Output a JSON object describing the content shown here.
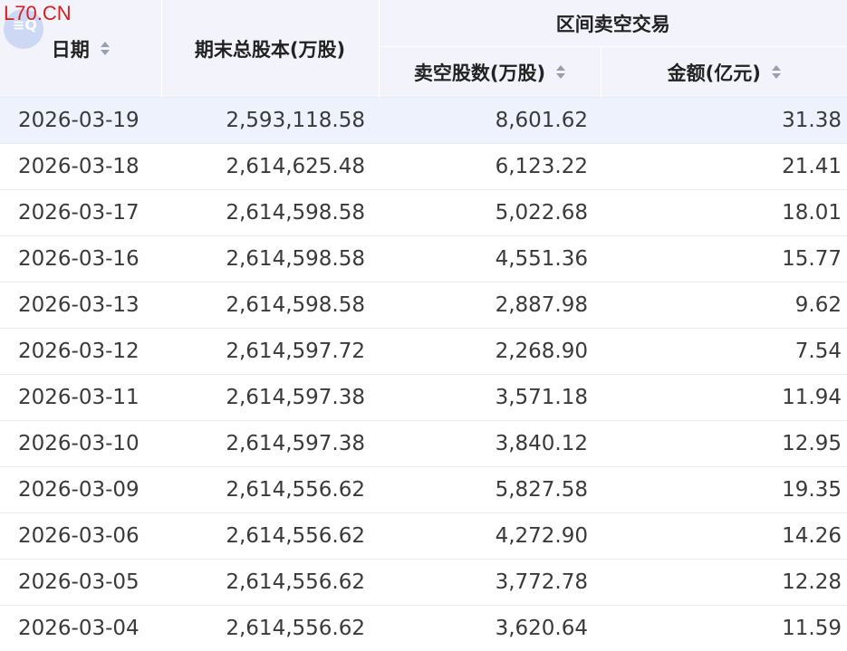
{
  "watermark": {
    "text": "L70.CN",
    "icon_glyph": "≡Q",
    "color": "#d81e1e"
  },
  "headers": {
    "date": "日期",
    "total_shares": "期末总股本(万股)",
    "short_group": "区间卖空交易",
    "short_count": "卖空股数(万股)",
    "amount": "金额(亿元)"
  },
  "rows": [
    {
      "date": "2026-03-19",
      "total_shares": "2,593,118.58",
      "short_count": "8,601.62",
      "amount": "31.38"
    },
    {
      "date": "2026-03-18",
      "total_shares": "2,614,625.48",
      "short_count": "6,123.22",
      "amount": "21.41"
    },
    {
      "date": "2026-03-17",
      "total_shares": "2,614,598.58",
      "short_count": "5,022.68",
      "amount": "18.01"
    },
    {
      "date": "2026-03-16",
      "total_shares": "2,614,598.58",
      "short_count": "4,551.36",
      "amount": "15.77"
    },
    {
      "date": "2026-03-13",
      "total_shares": "2,614,598.58",
      "short_count": "2,887.98",
      "amount": "9.62"
    },
    {
      "date": "2026-03-12",
      "total_shares": "2,614,597.72",
      "short_count": "2,268.90",
      "amount": "7.54"
    },
    {
      "date": "2026-03-11",
      "total_shares": "2,614,597.38",
      "short_count": "3,571.18",
      "amount": "11.94"
    },
    {
      "date": "2026-03-10",
      "total_shares": "2,614,597.38",
      "short_count": "3,840.12",
      "amount": "12.95"
    },
    {
      "date": "2026-03-09",
      "total_shares": "2,614,556.62",
      "short_count": "5,827.58",
      "amount": "19.35"
    },
    {
      "date": "2026-03-06",
      "total_shares": "2,614,556.62",
      "short_count": "4,272.90",
      "amount": "14.26"
    },
    {
      "date": "2026-03-05",
      "total_shares": "2,614,556.62",
      "short_count": "3,772.78",
      "amount": "12.28"
    },
    {
      "date": "2026-03-04",
      "total_shares": "2,614,556.62",
      "short_count": "3,620.64",
      "amount": "11.59"
    }
  ],
  "colors": {
    "header_bg": "#f2f3fb",
    "highlight_row": "#edf2fd",
    "row_border": "#e8eaf2"
  }
}
